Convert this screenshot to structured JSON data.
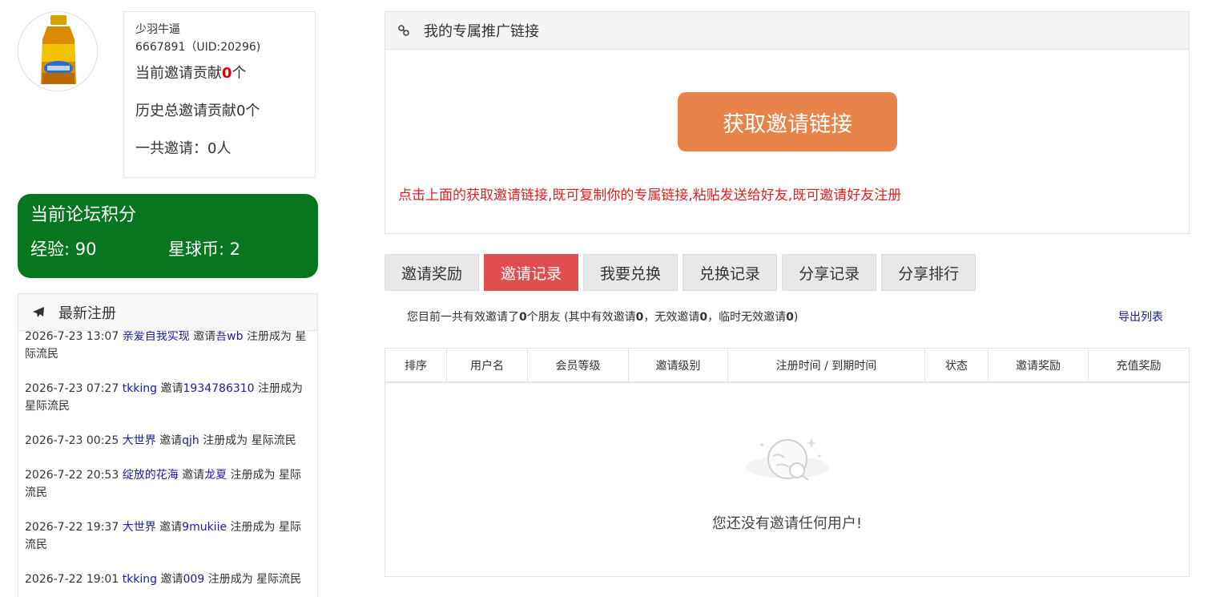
{
  "profile": {
    "avatar": "avatar-image",
    "username": "少羽牛逼",
    "uid_line": "6667891（UID:20296)",
    "current_contrib_label": "当前邀请贡献",
    "current_contrib_value": "0",
    "current_contrib_unit": "个",
    "history_contrib": "历史总邀请贡献0个",
    "total_invites": "一共邀请：0人"
  },
  "points": {
    "title": "当前论坛积分",
    "exp": "经验: 90",
    "coins": "星球币: 2"
  },
  "latest": {
    "title": "最新注册",
    "icon": "paper-plane-icon",
    "items": [
      {
        "time": "2026-7-23 13:07",
        "user": "亲爱自我实现",
        "mid": "邀请",
        "invitee": "吾wb",
        "tail": "注册成为 星际流民"
      },
      {
        "time": "2026-7-23 07:27",
        "user": "tkking",
        "mid": "邀请",
        "invitee": "1934786310",
        "tail": "注册成为 星际流民"
      },
      {
        "time": "2026-7-23 00:25",
        "user": "大世界",
        "mid": "邀请",
        "invitee": "qjh",
        "tail": "注册成为 星际流民"
      },
      {
        "time": "2026-7-22 20:53",
        "user": "绽放的花海",
        "mid": "邀请",
        "invitee": "龙夏",
        "tail": "注册成为 星际流民"
      },
      {
        "time": "2026-7-22 19:37",
        "user": "大世界",
        "mid": "邀请",
        "invitee": "9mukiie",
        "tail": "注册成为 星际流民"
      },
      {
        "time": "2026-7-22 19:01",
        "user": "tkking",
        "mid": "邀请",
        "invitee": "009",
        "tail": "注册成为 星际流民"
      }
    ]
  },
  "promo": {
    "title": "我的专属推广链接",
    "icon": "link-icon",
    "button": "获取邀请链接",
    "tip": "点击上面的获取邀请链接,既可复制你的专属链接,粘贴发送给好友,既可邀请好友注册"
  },
  "tabs": [
    "邀请奖励",
    "邀请记录",
    "我要兑换",
    "兑换记录",
    "分享记录",
    "分享排行"
  ],
  "active_tab": "邀请记录",
  "summary": {
    "prefix": "您目前一共有效邀请了",
    "count": "0",
    "mid1": "个朋友 (其中有效邀请",
    "valid": "0",
    "mid2": "，无效邀请",
    "invalid": "0",
    "mid3": "，临时无效邀请",
    "temp": "0",
    "suffix": ")"
  },
  "export": "导出列表",
  "table": {
    "columns": [
      "排序",
      "用户名",
      "会员等级",
      "邀请级别",
      "注册时间 / 到期时间",
      "状态",
      "邀请奖励",
      "充值奖励"
    ],
    "empty_icon": "empty-moon-icon",
    "empty_text": "您还没有邀请任何用户!"
  },
  "colors": {
    "points_bg": "#07761f",
    "button_orange": "#e8844a",
    "tab_active": "#e04e4e",
    "tip_red": "#e02020",
    "link_blue": "#1a1aa6"
  }
}
